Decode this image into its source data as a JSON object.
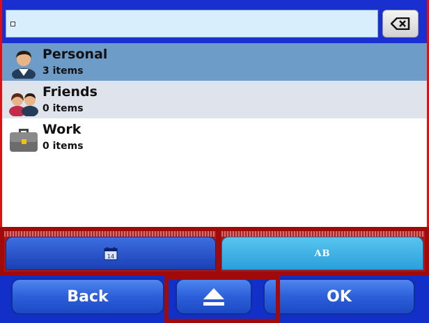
{
  "list": {
    "items": [
      {
        "title": "Personal",
        "count": "3 items",
        "icon": "person-icon"
      },
      {
        "title": "Friends",
        "count": "0 items",
        "icon": "friends-icon"
      },
      {
        "title": "Work",
        "count": "0 items",
        "icon": "briefcase-icon"
      }
    ]
  },
  "tabs": {
    "calendar_day": "14",
    "ab_label": "AB"
  },
  "buttons": {
    "back": "Back",
    "ok": "OK"
  },
  "colors": {
    "selected_row": "#6e9cc9",
    "frame_blue": "#1a2fd0",
    "highlight_red": "#a10a0a"
  }
}
